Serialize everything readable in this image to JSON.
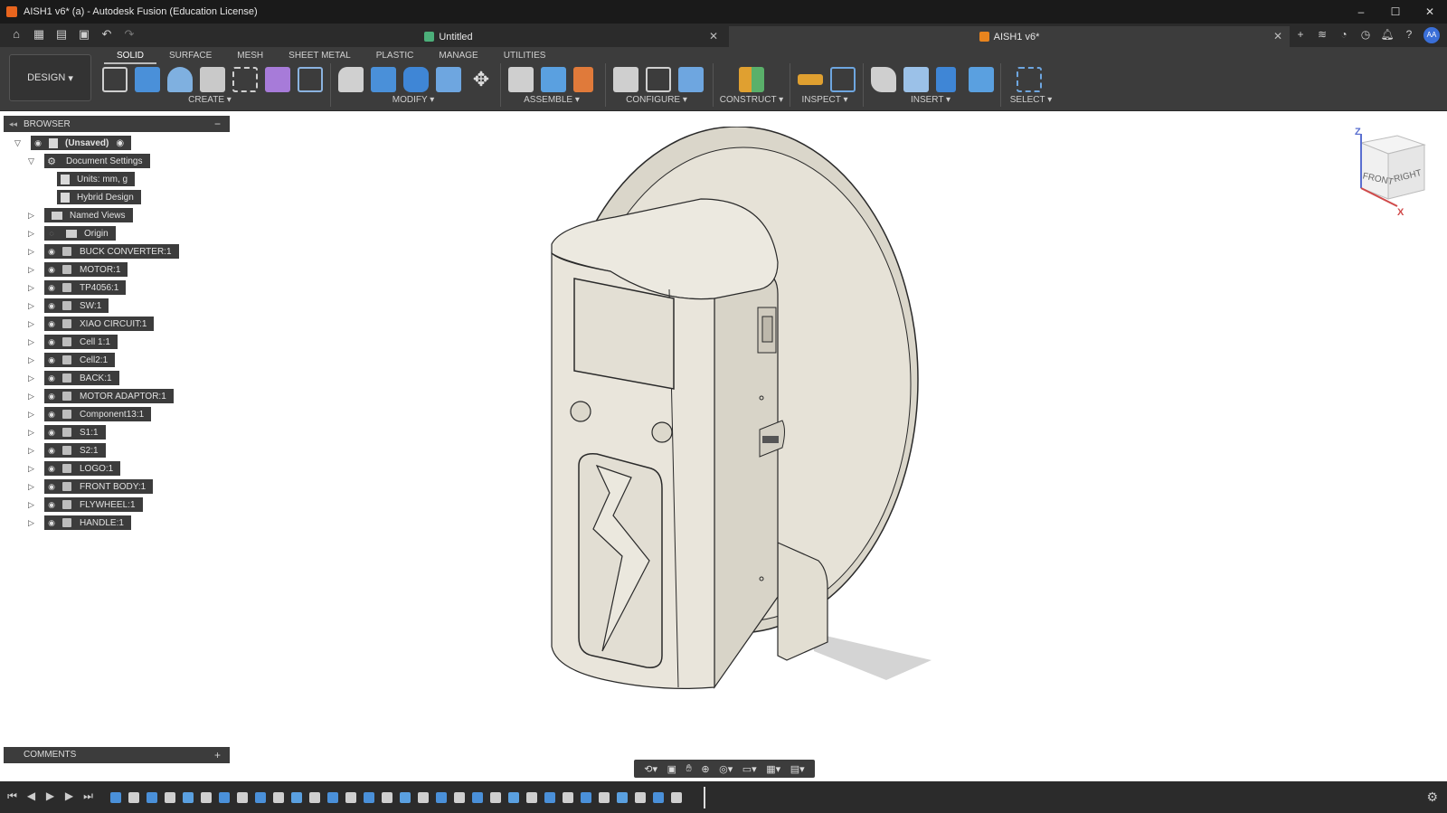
{
  "window": {
    "title": "AISH1 v6* (a) - Autodesk Fusion (Education License)",
    "controls": [
      "–",
      "☐",
      "✕"
    ]
  },
  "tabs": [
    {
      "label": "Untitled",
      "icon": "drawing-icon"
    },
    {
      "label": "AISH1 v6*",
      "icon": "design-icon",
      "active": true
    }
  ],
  "ribbon": {
    "workspace": "DESIGN",
    "workspace_tabs": [
      "SOLID",
      "SURFACE",
      "MESH",
      "SHEET METAL",
      "PLASTIC",
      "MANAGE",
      "UTILITIES"
    ],
    "groups": [
      "CREATE",
      "MODIFY",
      "ASSEMBLE",
      "CONFIGURE",
      "CONSTRUCT",
      "INSPECT",
      "INSERT",
      "SELECT"
    ]
  },
  "browser": {
    "title": "BROWSER",
    "root": "(Unsaved)",
    "document_settings": "Document Settings",
    "units": "Units: mm, g",
    "design_type": "Hybrid Design",
    "named_views": "Named Views",
    "origin": "Origin",
    "components": [
      "BUCK CONVERTER:1",
      "MOTOR:1",
      "TP4056:1",
      "SW:1",
      "XIAO CIRCUIT:1",
      "Cell 1:1",
      "Cell2:1",
      "BACK:1",
      "MOTOR ADAPTOR:1",
      "Component13:1",
      "S1:1",
      "S2:1",
      "LOGO:1",
      "FRONT BODY:1",
      "FLYWHEEL:1",
      "HANDLE:1"
    ]
  },
  "comments": {
    "title": "COMMENTS"
  },
  "viewcube": {
    "front": "FRONT",
    "right": "RIGHT",
    "z": "Z",
    "x": "X"
  },
  "user": {
    "initials": "AA"
  },
  "colors": {
    "accent": "#3a8fd8",
    "model": "#e8e5db",
    "chrome": "#3c3c3c"
  }
}
